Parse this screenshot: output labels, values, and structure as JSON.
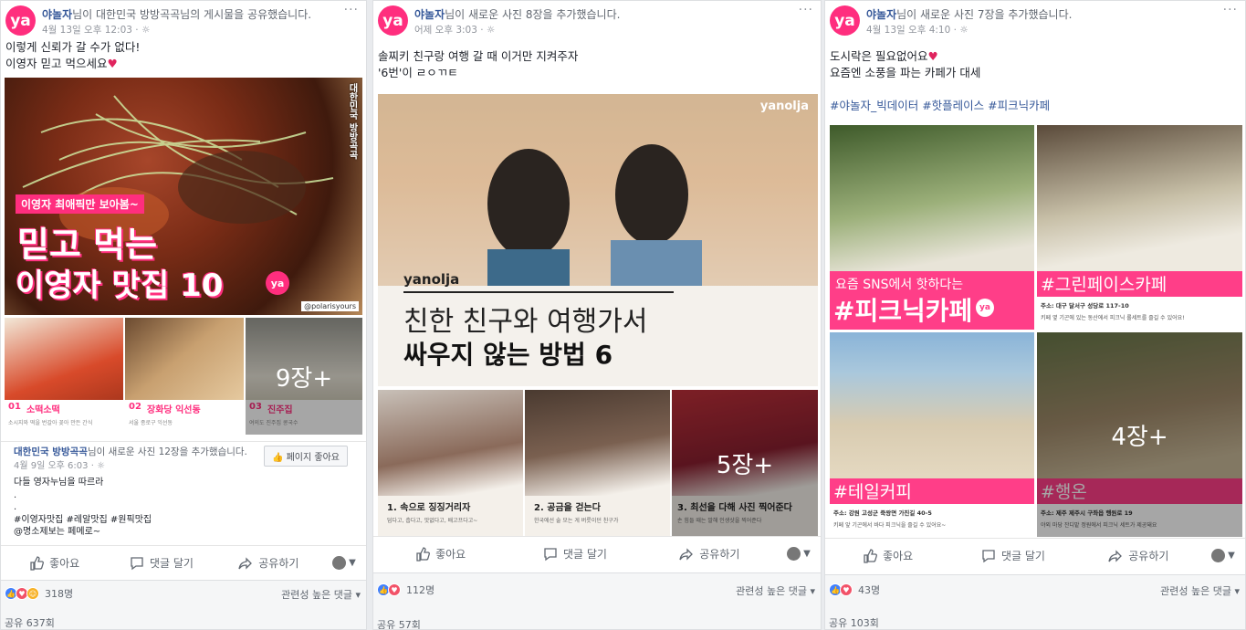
{
  "posts": [
    {
      "page": "야놀자",
      "action": "님이 대한민국 방방곡곡님의 게시물을 공유했습니다.",
      "time": "4월 13일 오후 12:03 · ",
      "text_lines": [
        "이렇게 신뢰가 갈 수가 없다!",
        "이영자 믿고 먹으세요"
      ],
      "main_image": {
        "tag": "대한민국 방방곡곡",
        "sub": "이영자 최애픽만 보아봄~",
        "title_1": "믿고 먹는",
        "title_2": "이영자 맛집 10",
        "credit": "@polarisyours"
      },
      "thumbs": [
        {
          "num": "01",
          "name": "소떡소떡",
          "note": "소시지와 떡을 번갈아 꽂아 만든 간식"
        },
        {
          "num": "02",
          "name": "장화당 익선동",
          "note": "서울 종로구 익선동"
        },
        {
          "num": "03",
          "name": "진주집",
          "note": "여의도 진주집 콩국수"
        }
      ],
      "more_count": "9장+",
      "shared": {
        "page": "대한민국 방방곡곡",
        "action": "님이 새로운 사진 12장을 추가했습니다.",
        "time": "4월 9일 오후 6:03 · ",
        "like_page": "페이지 좋아요",
        "lines": [
          "다들 영자누님을 따르라",
          ".",
          ".",
          "#이영자맛집 #레알맛집 #원픽맛집",
          "@명소제보는 페메로~"
        ]
      },
      "actions": {
        "like": "좋아요",
        "comment": "댓글 달기",
        "share": "공유하기"
      },
      "reactions": "318명",
      "relevance": "관련성 높은 댓글",
      "shares": "공유 637회"
    },
    {
      "page": "야놀자",
      "action": "님이 새로운 사진 8장을 추가했습니다.",
      "time": "어제 오후 3:03 · ",
      "text_lines": [
        "솔찌키 친구랑 여행 갈 때 이거만 지켜주자",
        "'6번'이 ㄹㅇㄲㅌ"
      ],
      "main_image": {
        "brand": "yanolja",
        "brand2": "yanolja",
        "title_1": "친한 친구와 여행가서",
        "title_2": "싸우지 않는 방법 6"
      },
      "thumbs": [
        {
          "caption": "1. 속으로 징징거리자",
          "note": "덥다고, 춥다고, 맛없다고, 배고프다고~"
        },
        {
          "caption": "2. 공금을 걷는다",
          "note": "한국에선 술 모는 게 버릇이던 친구가"
        },
        {
          "caption": "3. 최선을 다해 사진 찍어준다",
          "note": "손 힘들 때는 말해 인생샷을 찍어준다"
        }
      ],
      "more_count": "5장+",
      "actions": {
        "like": "좋아요",
        "comment": "댓글 달기",
        "share": "공유하기"
      },
      "reactions": "112명",
      "relevance": "관련성 높은 댓글",
      "shares": "공유 57회"
    },
    {
      "page": "야놀자",
      "action": "님이 새로운 사진 7장을 추가했습니다.",
      "time": "4월 13일 오후 4:10 · ",
      "text_lines": [
        "도시락은 필요없어요",
        "요즘엔 소풍을 파는 카페가 대세"
      ],
      "hashtags": "#야놀자_빅데이터 #핫플레이스 #피크닉카페",
      "tiles": [
        {
          "top": "요즘 SNS에서 핫하다는",
          "big": "#피크닉카페"
        },
        {
          "big": "#그린페이스카페",
          "addr": "주소: 대구 달서구 성당로 117-10",
          "tip": "키페 옆 기곤에 있는 동산에서 피크닉 롤세트를 즐길 수 있어요!"
        },
        {
          "big": "#테일커피",
          "addr": "주소: 강원 고성군 죽왕면 가진길 40-5",
          "tip": "키페 앞 기곤에서 바다 피크닉을 즐길 수 있어요~"
        },
        {
          "big": "#행온",
          "addr": "주소: 제주 제주시 구좌읍 행원로 19",
          "tip": "야외 마당 잔디밭 정원에서 피크닉 세트가 제공돼요"
        }
      ],
      "more_count": "4장+",
      "actions": {
        "like": "좋아요",
        "comment": "댓글 달기",
        "share": "공유하기"
      },
      "reactions": "43명",
      "relevance": "관련성 높은 댓글",
      "shares": "공유 103회"
    }
  ],
  "colors": {
    "brand": "#ff2e7e",
    "link": "#365899",
    "accent_pink": "#ff3e88"
  },
  "icons": [
    "more-icon",
    "globe-icon",
    "heart-icon",
    "thumb-icon",
    "comment-icon",
    "share-arrow-icon",
    "caret-down-icon"
  ]
}
